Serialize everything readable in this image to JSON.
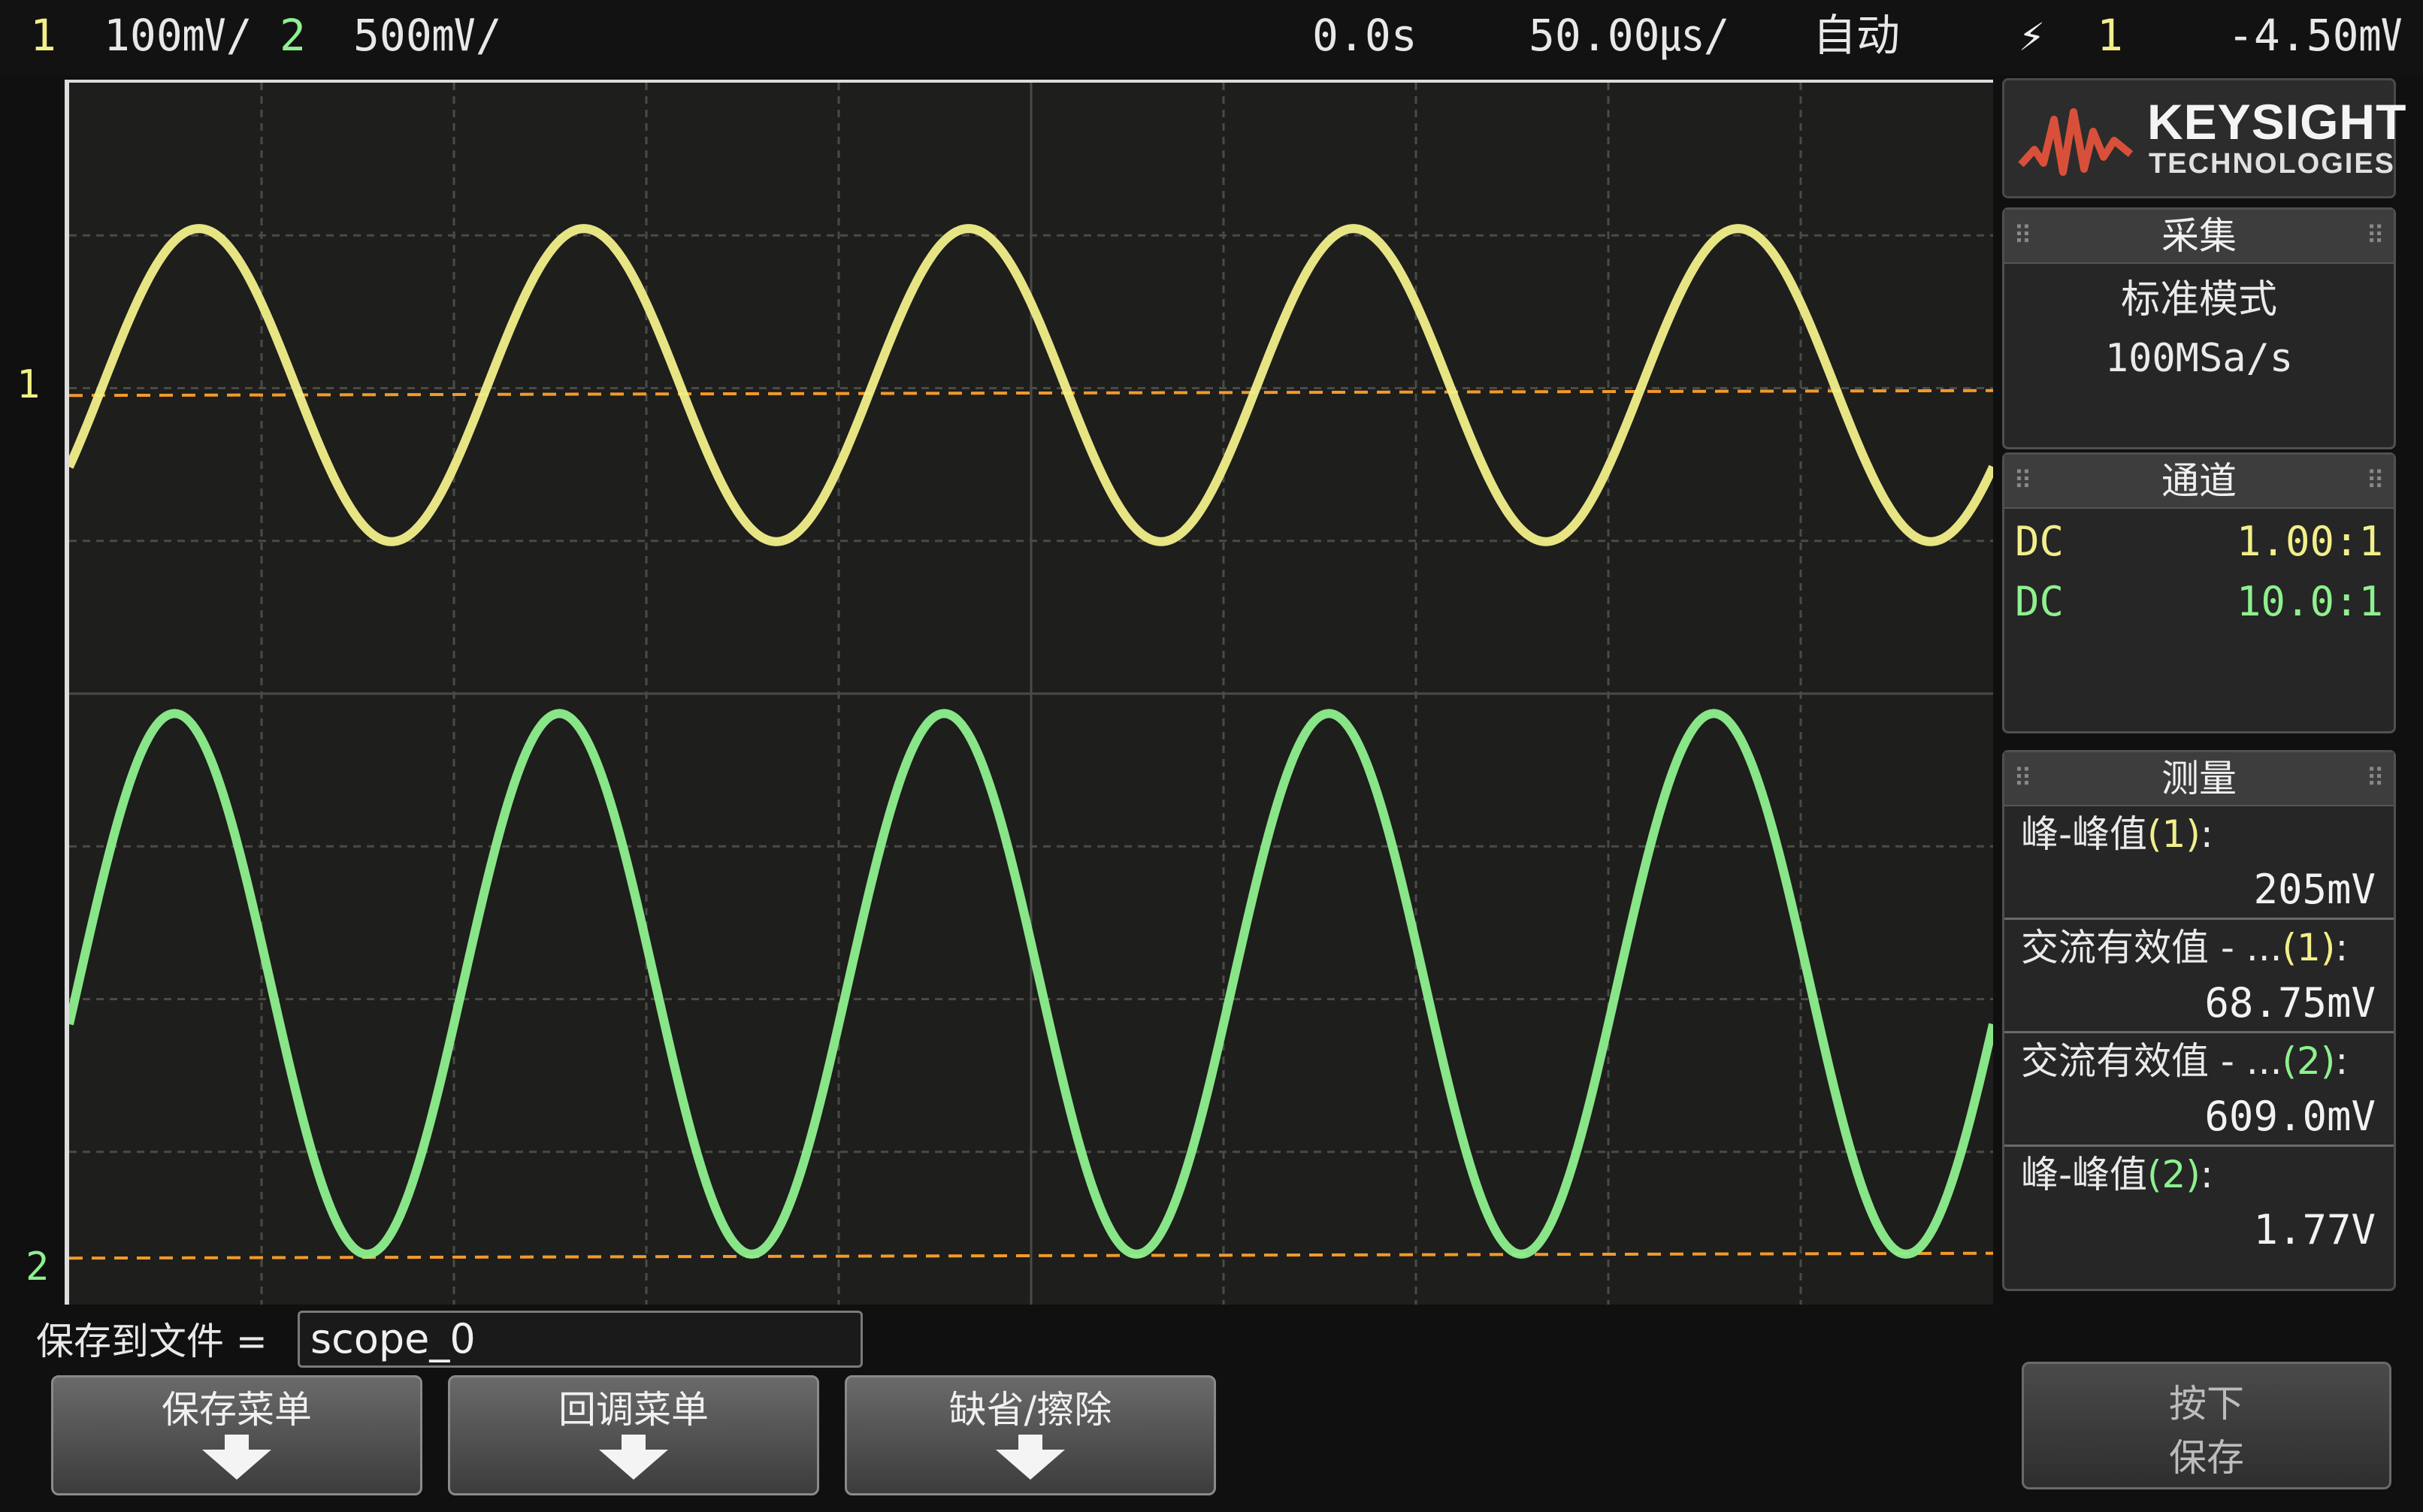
{
  "top_bar": {
    "ch1_num": "1",
    "ch1_scale": "100㎷/",
    "ch2_num": "2",
    "ch2_scale": "500㎷/",
    "time_offset": "0.0s",
    "time_scale": "50.00㎲/",
    "trigger_mode": "自动",
    "trigger_source": "1",
    "trigger_level": "-4.50㎷"
  },
  "colors": {
    "ch1": "#f2ef8a",
    "ch2": "#8ef08e",
    "trigger": "#f29a2a",
    "grid": "#4a4a46",
    "background": "#1e1e1c"
  },
  "waveforms": {
    "ch1_marker": "1",
    "ch2_marker": "2",
    "ch1": {
      "shape": "sine",
      "cycles_on_screen": 5,
      "peak_to_peak_divisions": 2.05
    },
    "ch2": {
      "shape": "sine",
      "cycles_on_screen": 5,
      "peak_to_peak_divisions": 3.54
    }
  },
  "side_panel": {
    "logo": {
      "brand": "KEYSIGHT",
      "sub": "TECHNOLOGIES"
    },
    "acquire": {
      "title": "采集",
      "mode": "标准模式",
      "rate": "100MSa/s"
    },
    "channels": {
      "title": "通道",
      "rows": [
        {
          "coupling": "DC",
          "probe": "1.00:1"
        },
        {
          "coupling": "DC",
          "probe": "10.0:1"
        }
      ]
    },
    "measure": {
      "title": "测量",
      "items": [
        {
          "label": "峰-峰值",
          "ch": "(1)",
          "suffix": ":",
          "value": "205mV"
        },
        {
          "label": "交流有效值 - ...",
          "ch": "(1)",
          "suffix": ":",
          "value": "68.75mV"
        },
        {
          "label": "交流有效值 - ...",
          "ch": "(2)",
          "suffix": ":",
          "value": "609.0mV"
        },
        {
          "label": "峰-峰值",
          "ch": "(2)",
          "suffix": ":",
          "value": "1.77V"
        }
      ]
    }
  },
  "save_bar": {
    "label": "保存到文件 =",
    "filename": "scope_0"
  },
  "softkeys": [
    {
      "label": "保存菜单"
    },
    {
      "label": "回调菜单"
    },
    {
      "label": "缺省/擦除"
    }
  ],
  "press_key": {
    "line1": "按下",
    "line2": "保存"
  }
}
